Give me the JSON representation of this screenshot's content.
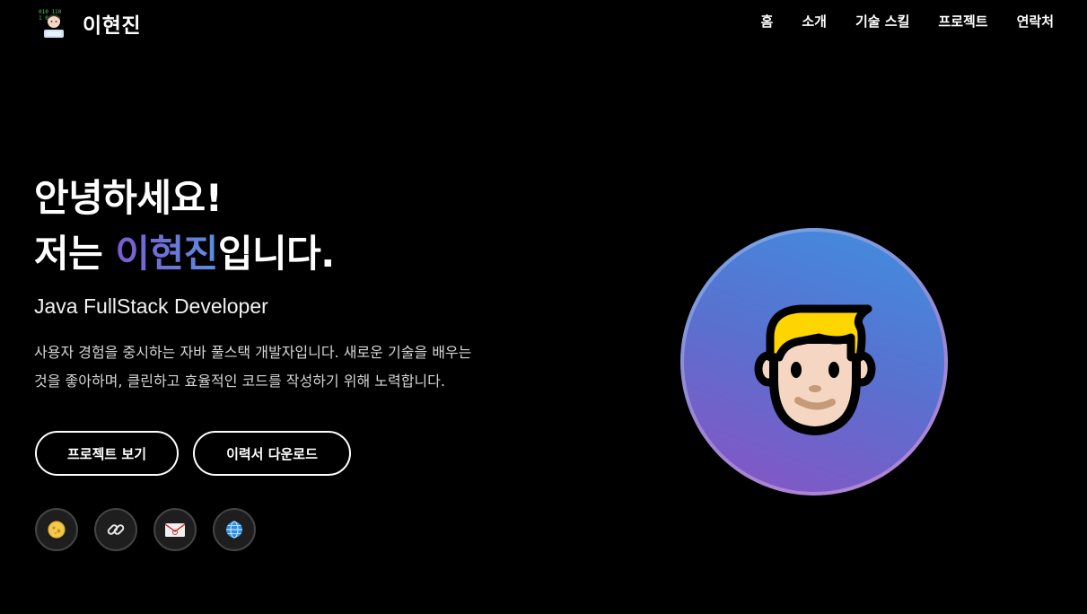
{
  "brand": {
    "name": "이현진",
    "logo_icon": "developer-avatar-icon"
  },
  "nav": {
    "items": [
      {
        "label": "홈"
      },
      {
        "label": "소개"
      },
      {
        "label": "기술 스킬"
      },
      {
        "label": "프로젝트"
      },
      {
        "label": "연락처"
      }
    ]
  },
  "hero": {
    "greeting": "안녕하세요!",
    "intro_prefix": "저는 ",
    "intro_name": "이현진",
    "intro_suffix": "입니다.",
    "role": "Java FullStack Developer",
    "description_line1": "사용자 경험을 중시하는 자바 풀스택 개발자입니다. 새로운 기술을 배우는",
    "description_line2": "것을 좋아하며, 클린하고 효율적인 코드를 작성하기 위해 노력합니다."
  },
  "buttons": {
    "projects": "프로젝트 보기",
    "resume": "이력서 다운로드"
  },
  "social": [
    {
      "icon": "github-cat-icon"
    },
    {
      "icon": "link-icon"
    },
    {
      "icon": "email-icon"
    },
    {
      "icon": "globe-icon"
    }
  ],
  "avatar": {
    "icon": "blond-person-emoji-icon"
  },
  "colors": {
    "background": "#000000",
    "accent_start": "#7d5ad0",
    "accent_end": "#5a8ee0",
    "hair": "#ffd500",
    "skin": "#f4d6c2"
  }
}
